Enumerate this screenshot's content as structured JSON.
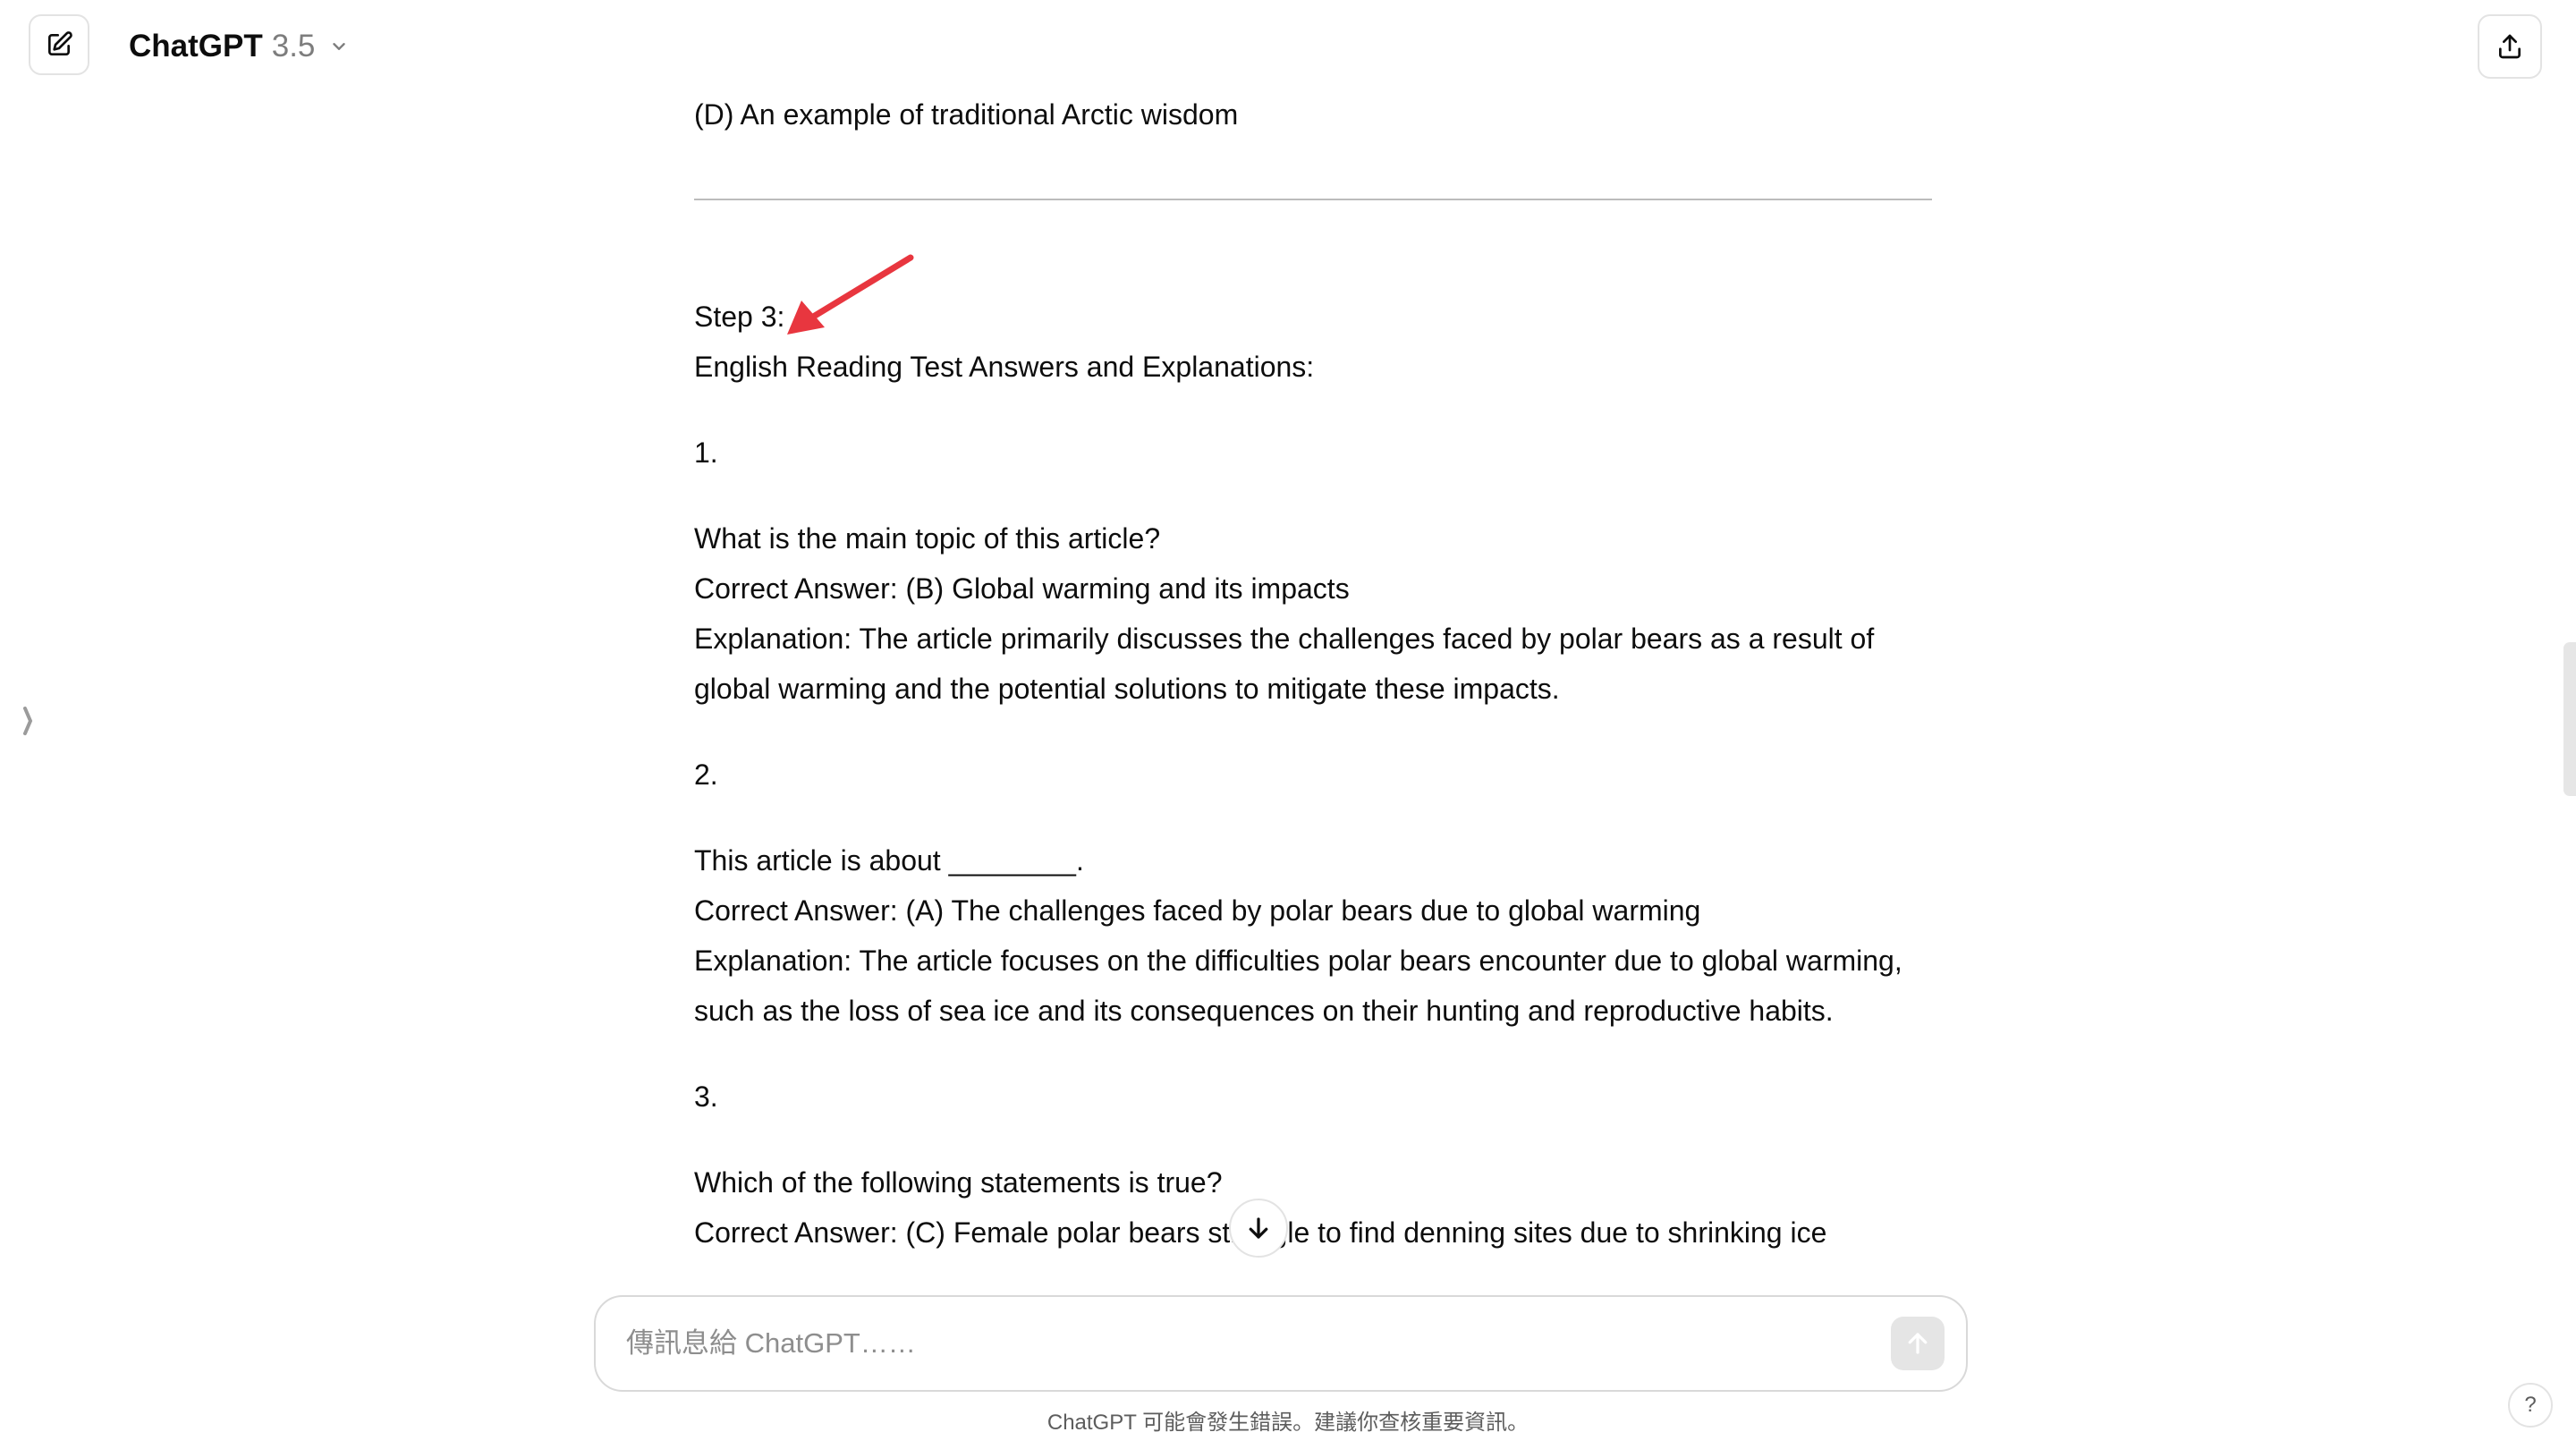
{
  "header": {
    "model_name": "ChatGPT",
    "model_version": "3.5"
  },
  "conversation": {
    "top_option": "(D) An example of traditional Arctic wisdom",
    "step_label": "Step 3:",
    "section_title": "English Reading Test Answers and Explanations:",
    "answers": [
      {
        "number": "1.",
        "question": "What is the main topic of this article?",
        "correct_answer": "Correct Answer: (B) Global warming and its impacts",
        "explanation": "Explanation: The article primarily discusses the challenges faced by polar bears as a result of global warming and the potential solutions to mitigate these impacts."
      },
      {
        "number": "2.",
        "question": "This article is about ________.",
        "correct_answer": "Correct Answer: (A) The challenges faced by polar bears due to global warming",
        "explanation": "Explanation: The article focuses on the difficulties polar bears encounter due to global warming, such as the loss of sea ice and its consequences on their hunting and reproductive habits."
      },
      {
        "number": "3.",
        "question": "Which of the following statements is true?",
        "correct_answer": "Correct Answer: (C) Female polar bears struggle to find denning sites due to shrinking ice",
        "explanation": ""
      }
    ]
  },
  "composer": {
    "placeholder": "傳訊息給 ChatGPT……"
  },
  "footer": {
    "disclaimer": "ChatGPT 可能會發生錯誤。建議你查核重要資訊。",
    "help_label": "?"
  },
  "colors": {
    "annotation_arrow": "#e8363f",
    "divider": "#bcbcbc",
    "send_button_disabled": "#e5e5e5"
  }
}
